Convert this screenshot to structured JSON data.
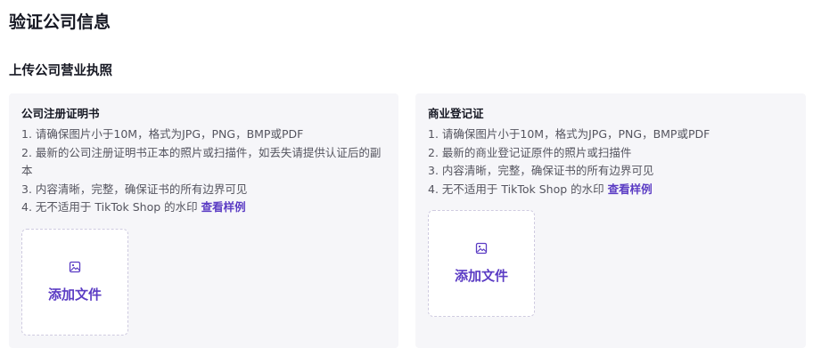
{
  "page": {
    "title": "验证公司信息",
    "section_title": "上传公司营业执照"
  },
  "accent_color": "#5b3cc4",
  "cards": [
    {
      "title": "公司注册证明书",
      "requirements": [
        "1. 请确保图片小于10M，格式为JPG，PNG，BMP或PDF",
        "2. 最新的公司注册证明书正本的照片或扫描件，如丢失请提供认证后的副本",
        "3. 内容清晰，完整，确保证书的所有边界可见",
        "4. 无不适用于 TikTok Shop 的水印"
      ],
      "sample_link": "查看样例",
      "upload_label": "添加文件",
      "upload_icon": "image-icon"
    },
    {
      "title": "商业登记证",
      "requirements": [
        "1. 请确保图片小于10M，格式为JPG，PNG，BMP或PDF",
        "2. 最新的商业登记证原件的照片或扫描件",
        "3. 内容清晰，完整，确保证书的所有边界可见",
        "4. 无不适用于 TikTok Shop 的水印"
      ],
      "sample_link": "查看样例",
      "upload_label": "添加文件",
      "upload_icon": "image-icon"
    }
  ]
}
